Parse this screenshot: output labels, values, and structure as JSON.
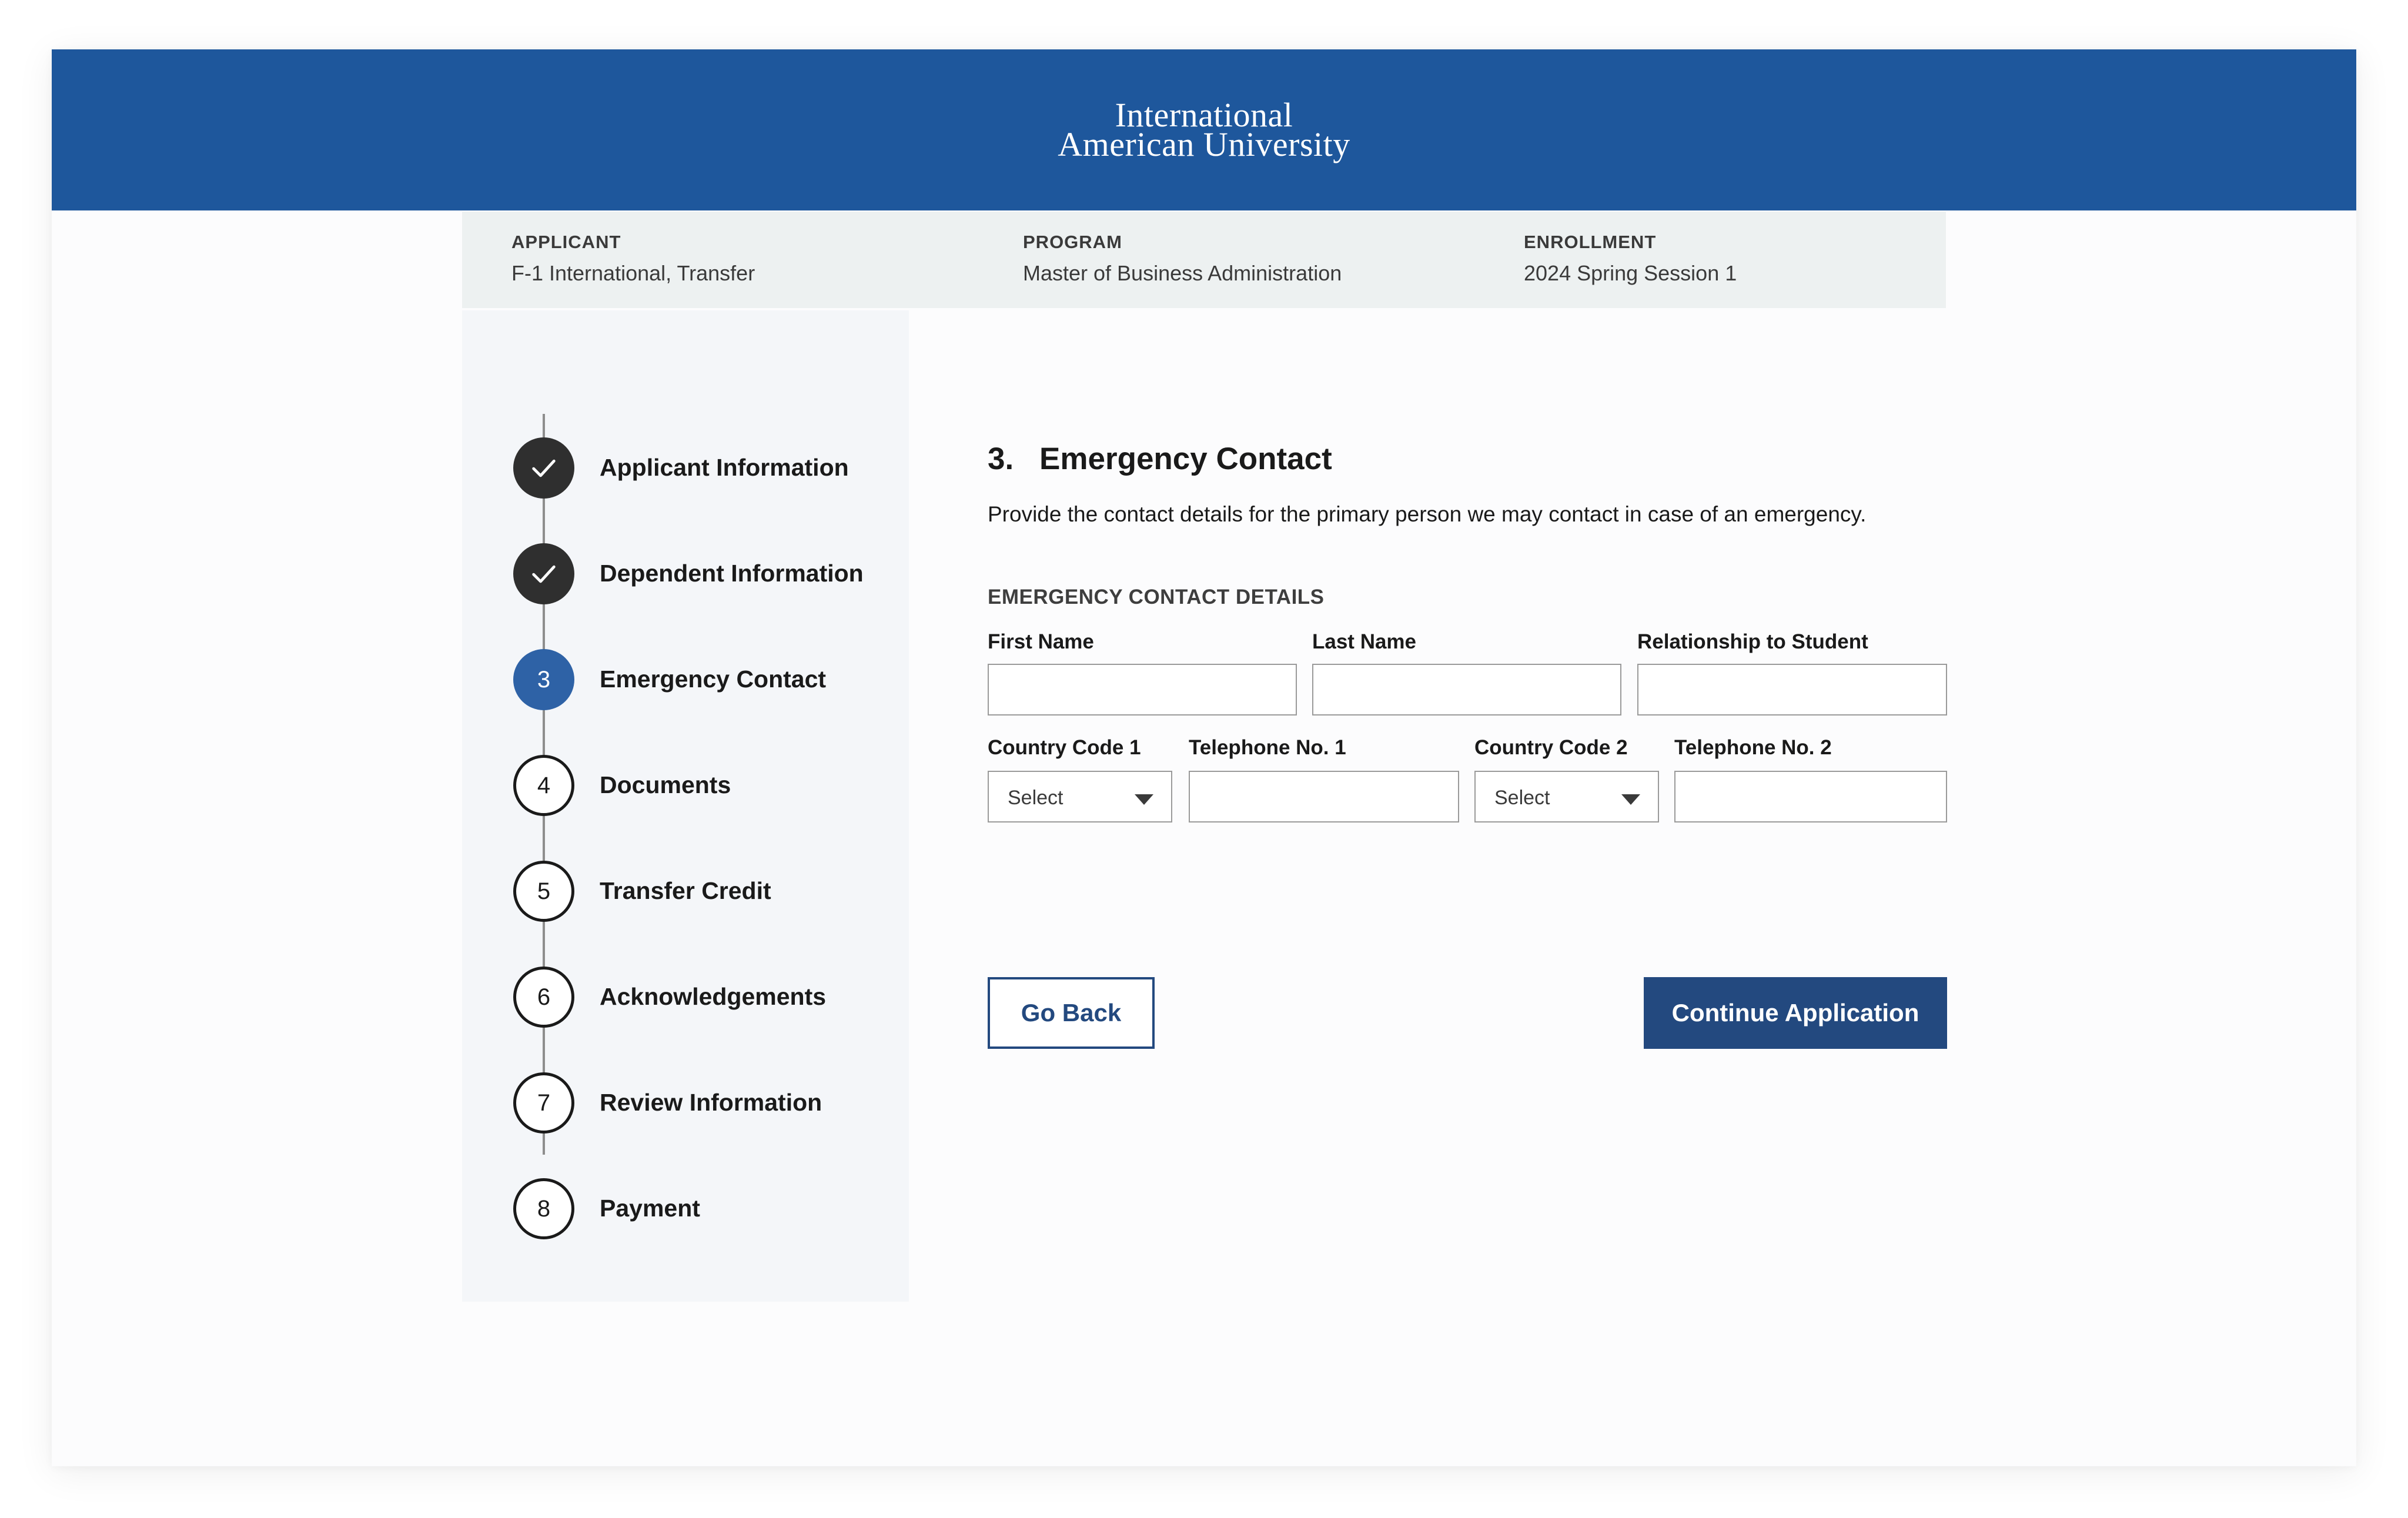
{
  "header": {
    "logo_line1": "International",
    "logo_line2": "American University"
  },
  "info": {
    "applicant_label": "APPLICANT",
    "applicant_value": "F-1 International, Transfer",
    "program_label": "PROGRAM",
    "program_value": "Master of Business Administration",
    "enrollment_label": "ENROLLMENT",
    "enrollment_value": "2024 Spring Session 1"
  },
  "steps": [
    {
      "number": "1",
      "label": "Applicant Information",
      "status": "complete",
      "icon": "check-icon"
    },
    {
      "number": "2",
      "label": "Dependent Information",
      "status": "complete",
      "icon": "check-icon"
    },
    {
      "number": "3",
      "label": "Emergency Contact",
      "status": "current"
    },
    {
      "number": "4",
      "label": "Documents",
      "status": "upcoming"
    },
    {
      "number": "5",
      "label": "Transfer Credit",
      "status": "upcoming"
    },
    {
      "number": "6",
      "label": "Acknowledgements",
      "status": "upcoming"
    },
    {
      "number": "7",
      "label": "Review Information",
      "status": "upcoming"
    },
    {
      "number": "8",
      "label": "Payment",
      "status": "upcoming"
    }
  ],
  "section": {
    "number": "3.",
    "title": "Emergency Contact",
    "description": "Provide the contact details for the primary person we may contact in case of an emergency.",
    "subsection": "EMERGENCY CONTACT DETAILS"
  },
  "form": {
    "first_name_label": "First Name",
    "first_name_value": "",
    "last_name_label": "Last Name",
    "last_name_value": "",
    "relationship_label": "Relationship to Student",
    "relationship_value": "",
    "country_code_1_label": "Country Code 1",
    "country_code_1_value": "Select",
    "telephone_1_label": "Telephone No. 1",
    "telephone_1_value": "",
    "country_code_2_label": "Country Code 2",
    "country_code_2_value": "Select",
    "telephone_2_label": "Telephone No. 2",
    "telephone_2_value": ""
  },
  "buttons": {
    "back": "Go Back",
    "continue": "Continue Application"
  },
  "colors": {
    "header_bg": "#1e579c",
    "primary_button": "#23497f",
    "active_step": "#2e62a6",
    "complete_step": "#2f2f2f",
    "info_bar_bg": "#edf1f1",
    "sidebar_bg": "#f4f6f9"
  }
}
